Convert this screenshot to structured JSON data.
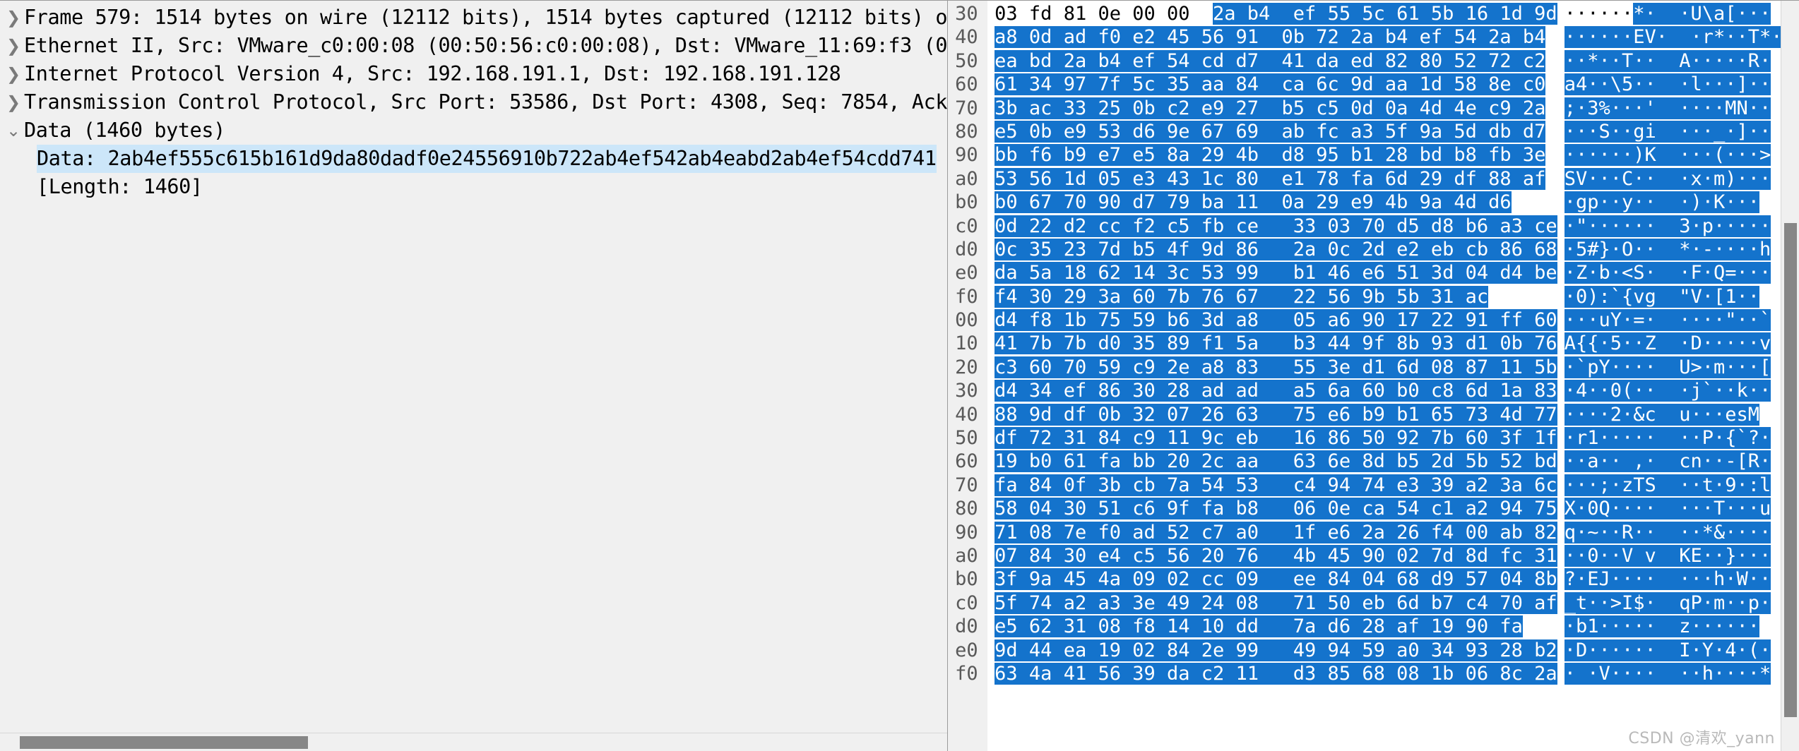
{
  "colors": {
    "selection_blue": "#1473cc",
    "tree_selection": "#cce6f9",
    "pane_bg": "#f0f0f0",
    "hex_bg": "#ffffff",
    "offset_text": "#595959",
    "scrollbar_thumb": "#878787",
    "watermark": "#b9b9b9"
  },
  "detail_pane": {
    "rows": [
      {
        "twisty": "collapsed",
        "indent": 0,
        "selected": false,
        "text": "Frame 579: 1514 bytes on wire (12112 bits), 1514 bytes captured (12112 bits) o"
      },
      {
        "twisty": "collapsed",
        "indent": 0,
        "selected": false,
        "text": "Ethernet II, Src: VMware_c0:00:08 (00:50:56:c0:00:08), Dst: VMware_11:69:f3 (0"
      },
      {
        "twisty": "collapsed",
        "indent": 0,
        "selected": false,
        "text": "Internet Protocol Version 4, Src: 192.168.191.1, Dst: 192.168.191.128"
      },
      {
        "twisty": "collapsed",
        "indent": 0,
        "selected": false,
        "text": "Transmission Control Protocol, Src Port: 53586, Dst Port: 4308, Seq: 7854, Ack"
      },
      {
        "twisty": "expanded",
        "indent": 0,
        "selected": false,
        "text": "Data (1460 bytes)"
      },
      {
        "twisty": "none",
        "indent": 1,
        "selected": true,
        "text": "Data: 2ab4ef555c615b161d9da80dadf0e24556910b722ab4ef542ab4eabd2ab4ef54cdd741"
      },
      {
        "twisty": "none",
        "indent": 1,
        "selected": false,
        "text": "[Length: 1460]"
      }
    ]
  },
  "hex_pane": {
    "rows": [
      {
        "offset": "30",
        "bytes": "03 fd 81 0e 00 00  2a b4  ef 55 5c 61 5b 16 1d 9d",
        "ascii": "······*·  ·U\\a[···",
        "sel_hex_start": 19,
        "sel_ascii_start": 6
      },
      {
        "offset": "40",
        "bytes": "a8 0d ad f0 e2 45 56 91  0b 72 2a b4 ef 54 2a b4",
        "ascii": "······EV·  ·r*··T*·",
        "sel_hex_start": 0,
        "sel_ascii_start": 0
      },
      {
        "offset": "50",
        "bytes": "ea bd 2a b4 ef 54 cd d7  41 da ed 82 80 52 72 c2",
        "ascii": "··*··T··  A·····R·",
        "sel_hex_start": 0,
        "sel_ascii_start": 0
      },
      {
        "offset": "60",
        "bytes": "61 34 97 7f 5c 35 aa 84  ca 6c 9d aa 1d 58 8e c0",
        "ascii": "a4··\\5··  ·l···]··",
        "sel_hex_start": 0,
        "sel_ascii_start": 0
      },
      {
        "offset": "70",
        "bytes": "3b ac 33 25 0b c2 e9 27  b5 c5 0d 0a 4d 4e c9 2a",
        "ascii": ";·3%···'  ····MN··",
        "sel_hex_start": 0,
        "sel_ascii_start": 0
      },
      {
        "offset": "80",
        "bytes": "e5 0b e9 53 d6 9e 67 69  ab fc a3 5f 9a 5d db d7",
        "ascii": "···S··gi  ···_·]··",
        "sel_hex_start": 0,
        "sel_ascii_start": 0
      },
      {
        "offset": "90",
        "bytes": "bb f6 b9 e7 e5 8a 29 4b  d8 95 b1 28 bd b8 fb 3e",
        "ascii": "······)K  ···(···>",
        "sel_hex_start": 0,
        "sel_ascii_start": 0
      },
      {
        "offset": "a0",
        "bytes": "53 56 1d 05 e3 43 1c 80  e1 78 fa 6d 29 df 88 af",
        "ascii": "SV···C··  ·x·m)···",
        "sel_hex_start": 0,
        "sel_ascii_start": 0
      },
      {
        "offset": "b0",
        "bytes": "b0 67 70 90 d7 79 ba 11  0a 29 e9 4b 9a 4d d6",
        "ascii": "·gp··y··  ·)·K···",
        "sel_hex_start": 0,
        "sel_ascii_start": 0
      },
      {
        "offset": "c0",
        "bytes": "0d 22 d2 cc f2 c5 fb ce   33 03 70 d5 d8 b6 a3 ce",
        "ascii": "·\"······  3·p·····",
        "sel_hex_start": 0,
        "sel_ascii_start": 0
      },
      {
        "offset": "d0",
        "bytes": "0c 35 23 7d b5 4f 9d 86   2a 0c 2d e2 eb cb 86 68",
        "ascii": "·5#}·O··  *·-····h",
        "sel_hex_start": 0,
        "sel_ascii_start": 0
      },
      {
        "offset": "e0",
        "bytes": "da 5a 18 62 14 3c 53 99   b1 46 e6 51 3d 04 d4 be",
        "ascii": "·Z·b·<S·  ·F·Q=···",
        "sel_hex_start": 0,
        "sel_ascii_start": 0
      },
      {
        "offset": "f0",
        "bytes": "f4 30 29 3a 60 7b 76 67   22 56 9b 5b 31 ac",
        "ascii": "·0):`{vg  \"V·[1··",
        "sel_hex_start": 0,
        "sel_ascii_start": 0
      },
      {
        "offset": "00",
        "bytes": "d4 f8 1b 75 59 b6 3d a8   05 a6 90 17 22 91 ff 60",
        "ascii": "···uY·=·  ····\"··`",
        "sel_hex_start": 0,
        "sel_ascii_start": 0
      },
      {
        "offset": "10",
        "bytes": "41 7b 7b d0 35 89 f1 5a   b3 44 9f 8b 93 d1 0b 76",
        "ascii": "A{{·5··Z  ·D·····v",
        "sel_hex_start": 0,
        "sel_ascii_start": 0
      },
      {
        "offset": "20",
        "bytes": "c3 60 70 59 c9 2e a8 83   55 3e d1 6d 08 87 11 5b",
        "ascii": "·`pY····  U>·m···[",
        "sel_hex_start": 0,
        "sel_ascii_start": 0
      },
      {
        "offset": "30",
        "bytes": "d4 34 ef 86 30 28 ad ad   a5 6a 60 b0 c8 6d 1a 83",
        "ascii": "·4··0(··  ·j`··k··",
        "sel_hex_start": 0,
        "sel_ascii_start": 0
      },
      {
        "offset": "40",
        "bytes": "88 9d df 0b 32 07 26 63   75 e6 b9 b1 65 73 4d 77",
        "ascii": "····2·&c  u···esM",
        "sel_hex_start": 0,
        "sel_ascii_start": 0
      },
      {
        "offset": "50",
        "bytes": "df 72 31 84 c9 11 9c eb   16 86 50 92 7b 60 3f 1f",
        "ascii": "·r1·····  ··P·{`?·",
        "sel_hex_start": 0,
        "sel_ascii_start": 0
      },
      {
        "offset": "60",
        "bytes": "19 b0 61 fa bb 20 2c aa   63 6e 8d b5 2d 5b 52 bd",
        "ascii": "··a·· ,·  cn··-[R·",
        "sel_hex_start": 0,
        "sel_ascii_start": 0
      },
      {
        "offset": "70",
        "bytes": "fa 84 0f 3b cb 7a 54 53   c4 94 74 e3 39 a2 3a 6c",
        "ascii": "···;·zTS  ··t·9·:l",
        "sel_hex_start": 0,
        "sel_ascii_start": 0
      },
      {
        "offset": "80",
        "bytes": "58 04 30 51 c6 9f fa b8   06 0e ca 54 c1 a2 94 75",
        "ascii": "X·0Q····  ···T···u",
        "sel_hex_start": 0,
        "sel_ascii_start": 0
      },
      {
        "offset": "90",
        "bytes": "71 08 7e f0 ad 52 c7 a0   1f e6 2a 26 f4 00 ab 82",
        "ascii": "q·~··R··  ··*&····",
        "sel_hex_start": 0,
        "sel_ascii_start": 0
      },
      {
        "offset": "a0",
        "bytes": "07 84 30 e4 c5 56 20 76   4b 45 90 02 7d 8d fc 31",
        "ascii": "··0··V v  KE··}···",
        "sel_hex_start": 0,
        "sel_ascii_start": 0
      },
      {
        "offset": "b0",
        "bytes": "3f 9a 45 4a 09 02 cc 09   ee 84 04 68 d9 57 04 8b",
        "ascii": "?·EJ····  ···h·W··",
        "sel_hex_start": 0,
        "sel_ascii_start": 0
      },
      {
        "offset": "c0",
        "bytes": "5f 74 a2 a3 3e 49 24 08   71 50 eb 6d b7 c4 70 af",
        "ascii": "_t··>I$·  qP·m··p·",
        "sel_hex_start": 0,
        "sel_ascii_start": 0
      },
      {
        "offset": "d0",
        "bytes": "e5 62 31 08 f8 14 10 dd   7a d6 28 af 19 90 fa",
        "ascii": "·b1·····  z······",
        "sel_hex_start": 0,
        "sel_ascii_start": 0
      },
      {
        "offset": "e0",
        "bytes": "9d 44 ea 19 02 84 2e 99   49 94 59 a0 34 93 28 b2",
        "ascii": "·D······  I·Y·4·(·",
        "sel_hex_start": 0,
        "sel_ascii_start": 0
      },
      {
        "offset": "f0",
        "bytes": "63 4a 41 56 39 da c2 11   d3 85 68 08 1b 06 8c 2a",
        "ascii": "· ·V····  ··h····*",
        "sel_hex_start": 0,
        "sel_ascii_start": 0
      }
    ]
  },
  "scrollbars": {
    "horizontal_label": "horizontal-scrollbar",
    "vertical_label": "vertical-scrollbar"
  },
  "watermark": {
    "text": "CSDN @清欢_yann"
  }
}
